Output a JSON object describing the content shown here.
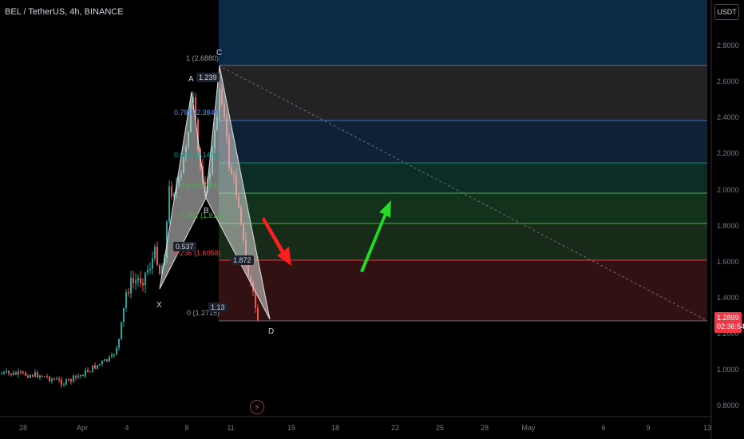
{
  "header": {
    "symbol_title": "BEL / TetherUS, 4h, BINANCE"
  },
  "price_axis": {
    "currency_button": "USDT",
    "ticks": [
      "2.8000",
      "2.6000",
      "2.4000",
      "2.2000",
      "2.0000",
      "1.8000",
      "1.6000",
      "1.4000",
      "1.2000",
      "1.0000",
      "0.8000"
    ],
    "last_price": "1.2899",
    "countdown": "02:36:54"
  },
  "time_axis": {
    "ticks": [
      "28",
      "Apr",
      "4",
      "8",
      "11",
      "15",
      "18",
      "22",
      "25",
      "28",
      "May",
      "6",
      "9",
      "13"
    ]
  },
  "fib_levels": [
    {
      "label": "1 (2.6880)",
      "color": "#787b86"
    },
    {
      "label": "0.786 (2.3849)",
      "color": "#2962ff"
    },
    {
      "label": "0.618 (2.1461)",
      "color": "#089981"
    },
    {
      "label": "0.5 (1.9784)",
      "color": "#4caf50"
    },
    {
      "label": "0.382 (1.8126)",
      "color": "#4caf50"
    },
    {
      "label": "0.236 (1.6058)",
      "color": "#f23645"
    },
    {
      "label": "0 (1.2715)",
      "color": "#787b86"
    }
  ],
  "pattern": {
    "points": [
      "X",
      "A",
      "B",
      "C",
      "D"
    ],
    "ratios": [
      "1.239",
      "0.537",
      "1.872",
      "1.13"
    ]
  },
  "colors": {
    "up_candle": "#26a69a",
    "down_candle": "#ef5350",
    "pattern_fill": "#d9d9d9",
    "arrow_down": "#ff1f1f",
    "arrow_up": "#22dd22",
    "price_tag": "#f23645"
  },
  "icons": {
    "replay": "lightning-bolt-icon"
  }
}
